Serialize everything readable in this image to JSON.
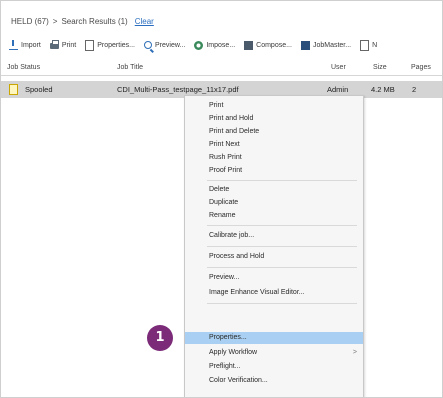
{
  "breadcrumb": {
    "queue": "HELD (67)",
    "separator": ">",
    "current": "Search Results (1)",
    "clear": "Clear"
  },
  "toolbar": {
    "buttons": [
      {
        "label": "Import",
        "icon": "import-icon"
      },
      {
        "label": "Print",
        "icon": "print-icon"
      },
      {
        "label": "Properties...",
        "icon": "properties-icon"
      },
      {
        "label": "Preview...",
        "icon": "preview-icon"
      },
      {
        "label": "Impose...",
        "icon": "impose-icon"
      },
      {
        "label": "Compose...",
        "icon": "compose-icon"
      },
      {
        "label": "JobMaster...",
        "icon": "jobmaster-icon"
      },
      {
        "label": "N",
        "icon": "document-icon"
      }
    ]
  },
  "grid": {
    "headers": {
      "status": "Job Status",
      "title": "Job Title",
      "user": "User",
      "size": "Size",
      "pages": "Pages"
    },
    "selected_row": {
      "status": "Spooled",
      "title": "CDI_Multi-Pass_testpage_11x17.pdf",
      "user": "Admin",
      "size": "4.2 MB",
      "pages": "2"
    }
  },
  "context_menu": {
    "items": [
      "Print",
      "Print and Hold",
      "Print and Delete",
      "Print Next",
      "Rush Print",
      "Proof Print",
      "Delete",
      "Duplicate",
      "Rename",
      "Calibrate job...",
      "Process and Hold",
      "Preview...",
      "Image Enhance Visual Editor...",
      "Properties...",
      "Apply Workflow",
      "Preflight...",
      "Color Verification..."
    ],
    "submenu_arrow": ">"
  },
  "annotation": {
    "step_number": "1",
    "color": "#7b2b78"
  },
  "colors": {
    "highlight": "#a9d0f2",
    "selected_row": "#d4d4d4",
    "link": "#2a6ebf"
  }
}
